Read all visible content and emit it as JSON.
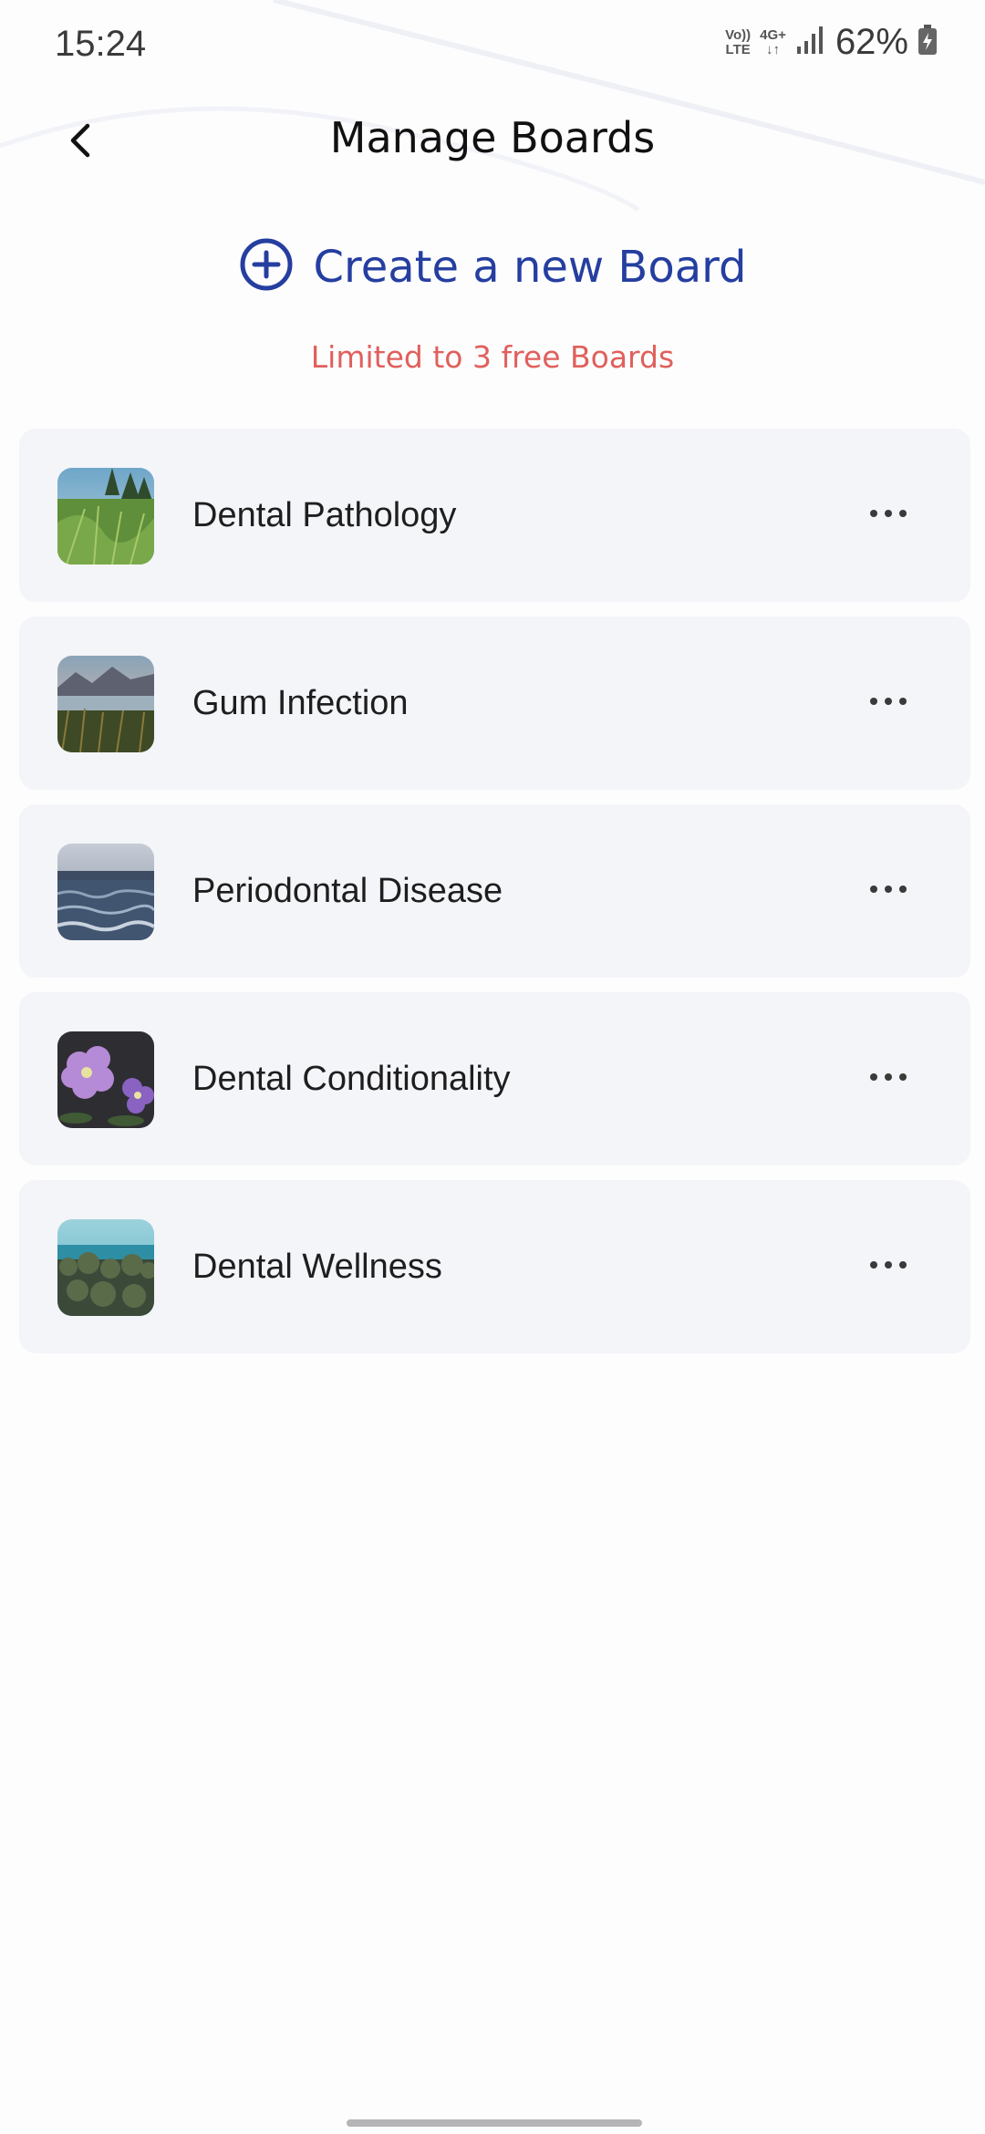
{
  "status_bar": {
    "time": "15:24",
    "volte_top": "Vo))",
    "volte_bottom": "LTE",
    "network_type": "4G+",
    "battery_percent": "62%"
  },
  "header": {
    "title": "Manage Boards"
  },
  "create_board": {
    "label": "Create a new Board",
    "limit_note": "Limited to 3 free Boards"
  },
  "boards": [
    {
      "name": "Dental Pathology",
      "thumbnail": "grass-meadow-image"
    },
    {
      "name": "Gum Infection",
      "thumbnail": "lake-mountains-image"
    },
    {
      "name": "Periodontal Disease",
      "thumbnail": "ocean-waves-image"
    },
    {
      "name": "Dental Conditionality",
      "thumbnail": "purple-flowers-image"
    },
    {
      "name": "Dental Wellness",
      "thumbnail": "coastal-shrubs-image"
    }
  ],
  "icons": {
    "back": "chevron-left-icon",
    "add": "plus-circle-icon",
    "more": "more-horizontal-icon"
  },
  "colors": {
    "accent": "#253ea0",
    "warning": "#e0605c",
    "card_background": "#f4f5f9"
  }
}
